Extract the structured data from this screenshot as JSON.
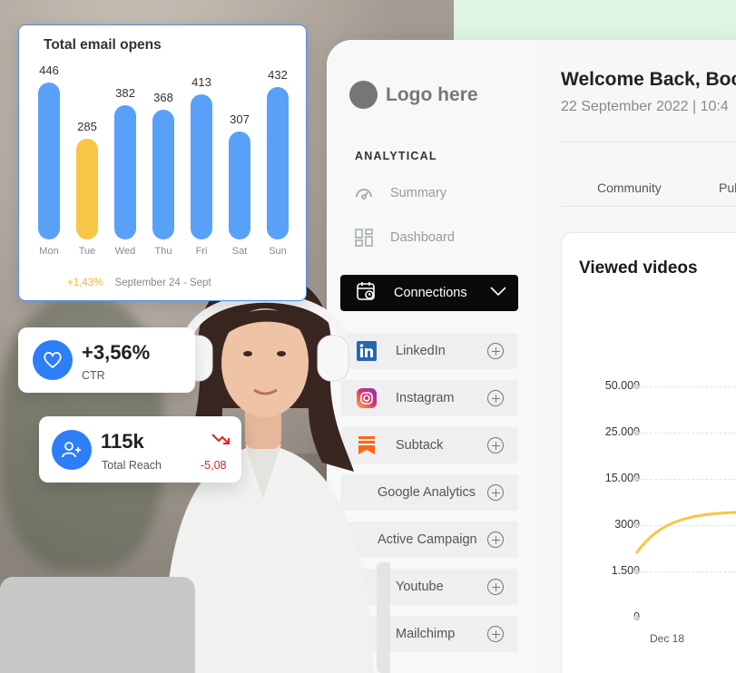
{
  "email_card": {
    "title": "Total email opens",
    "footer_pct": "+1,43%",
    "footer_date": "September 24 - Sept",
    "bar_color": "#59a1f8",
    "highlight_color": "#f8c544"
  },
  "chart_data": [
    {
      "type": "bar",
      "title": "Total email opens",
      "categories": [
        "Mon",
        "Tue",
        "Wed",
        "Thu",
        "Fri",
        "Sat",
        "Sun"
      ],
      "values": [
        446,
        285,
        382,
        368,
        413,
        307,
        432
      ],
      "highlighted": "Tue"
    },
    {
      "type": "line",
      "title": "Viewed videos",
      "y_ticks": [
        "50.000",
        "25.000",
        "15.000",
        "3000",
        "1.500",
        "0"
      ],
      "x_ticks": [
        "Dec 18"
      ],
      "line_color": "#f8c544"
    }
  ],
  "ctr_card": {
    "value": "+3,56%",
    "label": "CTR"
  },
  "reach_card": {
    "value": "115k",
    "label": "Total Reach",
    "delta": "-5,08"
  },
  "sidebar": {
    "logo": "Logo here",
    "section": "ANALYTICAL",
    "items": [
      {
        "label": "Summary",
        "icon": "gauge-icon"
      },
      {
        "label": "Dashboard",
        "icon": "grid-icon"
      }
    ],
    "connections": {
      "label": "Connections",
      "icon": "calendar-clock-icon"
    },
    "integrations": [
      {
        "label": "LinkedIn",
        "icon": "linkedin-icon"
      },
      {
        "label": "Instagram",
        "icon": "instagram-icon"
      },
      {
        "label": "Subtack",
        "icon": "substack-icon"
      },
      {
        "label": "Google Analytics",
        "icon": "google-analytics-icon"
      },
      {
        "label": "Active Campaign",
        "icon": "active-campaign-icon"
      },
      {
        "label": "Youtube",
        "icon": "youtube-icon"
      },
      {
        "label": "Mailchimp",
        "icon": "mailchimp-icon"
      }
    ]
  },
  "main": {
    "welcome": "Welcome Back, Boci",
    "date": "22 September 2022 | 10:4",
    "tabs": [
      "Community",
      "Pul"
    ],
    "video_card_title": "Viewed videos"
  }
}
